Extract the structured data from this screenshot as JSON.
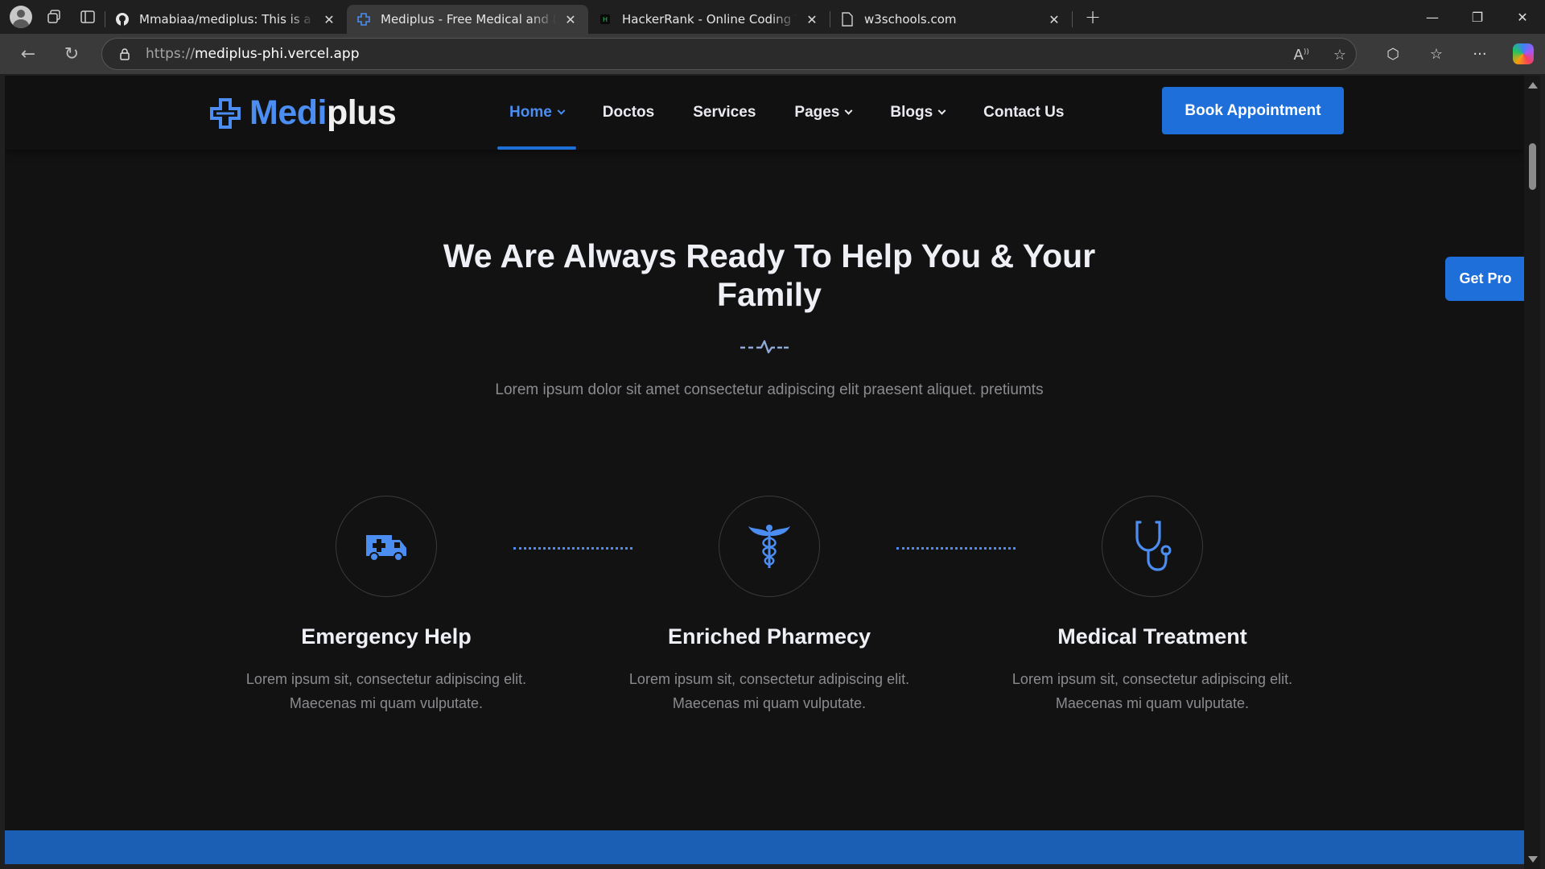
{
  "browser": {
    "tabs": [
      {
        "title": "Mmabiaa/mediplus: This is a simp",
        "favicon": "github-icon",
        "active": false
      },
      {
        "title": "Mediplus - Free Medical and Doct",
        "favicon": "mediplus-icon",
        "active": true
      },
      {
        "title": "HackerRank - Online Coding Tests",
        "favicon": "hackerrank-icon",
        "active": false
      },
      {
        "title": "w3schools.com",
        "favicon": "page-icon",
        "active": false
      }
    ],
    "url_protocol": "https://",
    "url_host": "mediplus-phi.vercel.app"
  },
  "site": {
    "logo_med": "Medi",
    "logo_plus": "plus",
    "nav": [
      {
        "label": "Home",
        "dropdown": true,
        "active": true
      },
      {
        "label": "Doctos",
        "dropdown": false,
        "active": false
      },
      {
        "label": "Services",
        "dropdown": false,
        "active": false
      },
      {
        "label": "Pages",
        "dropdown": true,
        "active": false
      },
      {
        "label": "Blogs",
        "dropdown": true,
        "active": false
      },
      {
        "label": "Contact Us",
        "dropdown": false,
        "active": false
      }
    ],
    "book_button": "Book Appointment",
    "get_pro": "Get Pro",
    "accent": "#1e6fd9"
  },
  "hero": {
    "title": "We Are Always Ready To Help You & Your Family",
    "subtitle": "Lorem ipsum dolor sit amet consectetur adipiscing elit praesent aliquet. pretiumts"
  },
  "features": [
    {
      "icon": "ambulance-icon",
      "title": "Emergency Help",
      "desc": "Lorem ipsum sit, consectetur adipiscing elit. Maecenas mi quam vulputate."
    },
    {
      "icon": "caduceus-icon",
      "title": "Enriched Pharmecy",
      "desc": "Lorem ipsum sit, consectetur adipiscing elit. Maecenas mi quam vulputate."
    },
    {
      "icon": "stethoscope-icon",
      "title": "Medical Treatment",
      "desc": "Lorem ipsum sit, consectetur adipiscing elit. Maecenas mi quam vulputate."
    }
  ]
}
